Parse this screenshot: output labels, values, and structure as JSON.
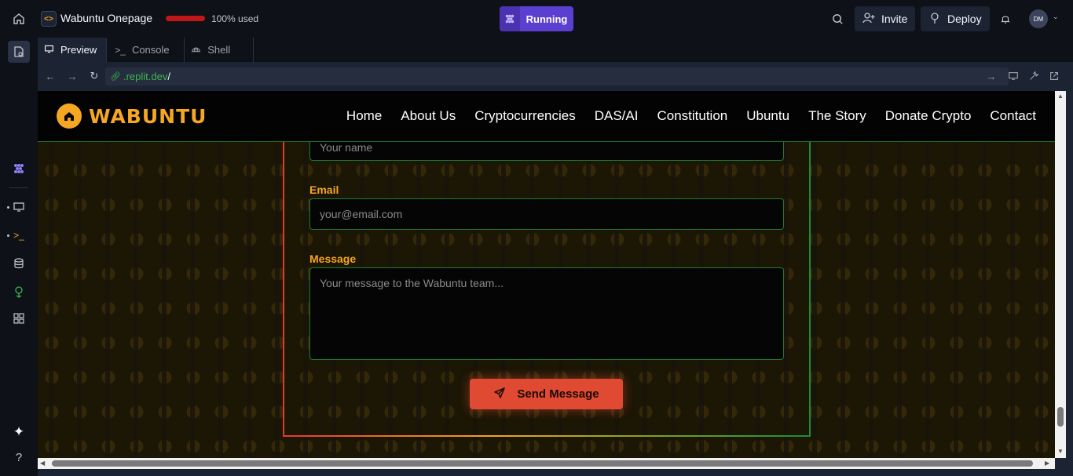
{
  "topbar": {
    "app_title": "Wabuntu Onepage",
    "usage_text": "100% used",
    "run_label": "Running",
    "invite_label": "Invite",
    "deploy_label": "Deploy",
    "avatar_initials": "DM",
    "usage_fraction": 1.0
  },
  "tabs": [
    {
      "label": "Preview",
      "icon": "monitor-icon"
    },
    {
      "label": "Console",
      "icon": "terminal-icon"
    },
    {
      "label": "Shell",
      "icon": "shell-icon"
    }
  ],
  "url": {
    "host": ".replit.dev",
    "path": "/"
  },
  "site": {
    "logo_text": "WABUNTU",
    "menu": [
      "Home",
      "About Us",
      "Cryptocurrencies",
      "DAS/AI",
      "Constitution",
      "Ubuntu",
      "The Story",
      "Donate Crypto",
      "Contact"
    ],
    "form": {
      "name_placeholder": "Your name",
      "email_label": "Email",
      "email_placeholder": "your@email.com",
      "message_label": "Message",
      "message_placeholder": "Your message to the Wabuntu team...",
      "send_label": "Send Message"
    }
  },
  "colors": {
    "accent": "#f5a623",
    "running": "#5a3fd1",
    "send_button": "#e04a32",
    "url_host": "#3ab64d"
  }
}
